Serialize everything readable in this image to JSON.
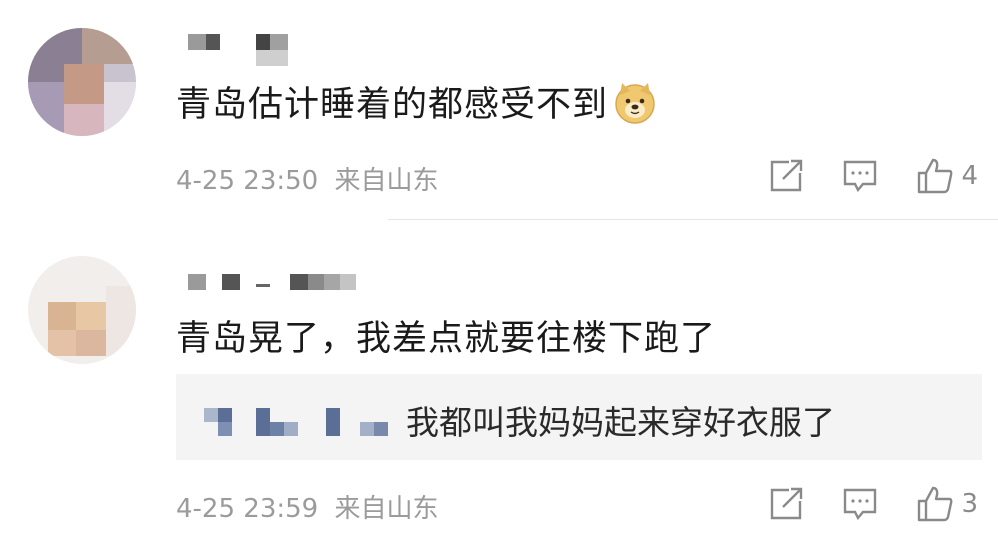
{
  "comments": [
    {
      "text": "青岛估计睡着的都感受不到",
      "emoji_icon": "doge-emoji-icon",
      "time": "4-25 23:50",
      "source": "来自山东",
      "likes": "4"
    },
    {
      "text": "青岛晃了，我差点就要往楼下跑了",
      "time": "4-25 23:59",
      "source": "来自山东",
      "likes": "3",
      "reply": {
        "text": "我都叫我妈妈起来穿好衣服了"
      }
    }
  ],
  "icons": [
    "repost-icon",
    "comment-icon",
    "like-icon"
  ]
}
